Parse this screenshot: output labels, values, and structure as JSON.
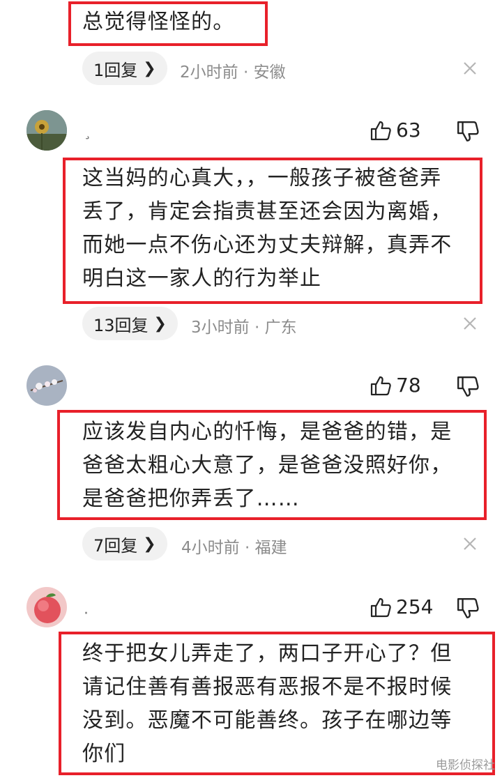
{
  "comments": [
    {
      "body": "总觉得怪怪的。",
      "replies": "1回复",
      "meta": "2小时前 · 安徽"
    },
    {
      "username": "¸",
      "likes": "63",
      "lines": [
        "这当妈的心真大，，一般孩子被爸爸弄",
        "丢了，肯定会指责甚至还会因为离婚，",
        "而她一点不伤心还为丈夫辩解，真弄不",
        "明白这一家人的行为举止"
      ],
      "replies": "13回复",
      "meta": "3小时前 · 广东"
    },
    {
      "likes": "78",
      "lines": [
        "应该发自内心的忏悔，是爸爸的错，是",
        "爸爸太粗心大意了，是爸爸没照好你，",
        "是爸爸把你弄丢了……"
      ],
      "replies": "7回复",
      "meta": "4小时前 · 福建"
    },
    {
      "username": "·",
      "likes": "254",
      "lines": [
        "终于把女儿弄走了，两口子开心了？但",
        "请记住善有善报恶有恶报不是不报时候",
        "没到。恶魔不可能善终。孩子在哪边等",
        "你们"
      ]
    }
  ],
  "icons": {
    "like": "thumbs-up-icon",
    "dislike": "thumbs-down-icon",
    "close": "close-icon",
    "chevron": "chevron-right-icon"
  },
  "colors": {
    "highlight_border": "#e8202a",
    "pill_bg": "#f1f1f1",
    "meta_text": "#8c8c8c"
  },
  "watermark": "电影侦探社"
}
